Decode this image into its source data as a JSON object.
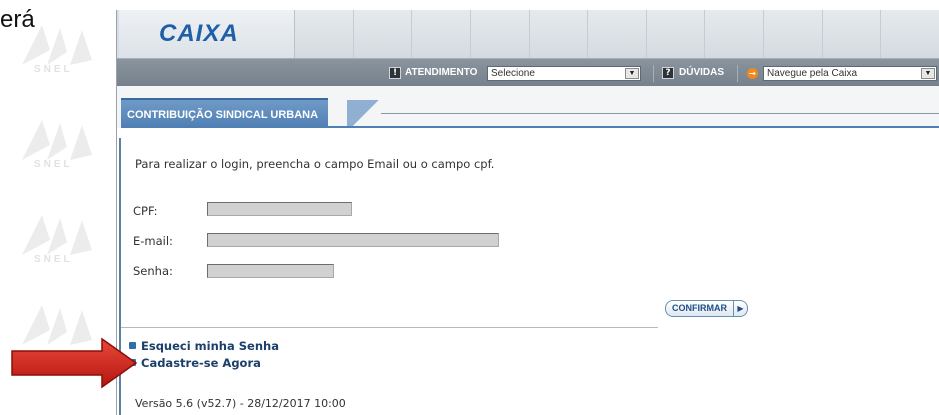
{
  "slide": {
    "fragment_text": "erá",
    "watermark_text": "SNEL"
  },
  "header": {
    "logo": "CAIXA"
  },
  "toolbar": {
    "atendimento_icon": "!",
    "atendimento_label": "ATENDIMENTO",
    "atendimento_select": "Selecione",
    "duvidas_icon": "?",
    "duvidas_label": "DÚVIDAS",
    "navegue_icon": "→",
    "navegue_select": "Navegue pela Caixa",
    "dropdown_glyph": "▼"
  },
  "tab": {
    "label": "CONTRIBUIÇÃO SINDICAL URBANA"
  },
  "login": {
    "intro": "Para realizar o login, preencha o campo Email ou o campo cpf.",
    "cpf_label": "CPF:",
    "email_label": "E-mail:",
    "senha_label": "Senha:",
    "cpf_value": "",
    "email_value": "",
    "senha_value": "",
    "confirm_label": "CONFIRMAR",
    "confirm_arrow": "▶"
  },
  "links": {
    "forgot": "Esqueci minha Senha",
    "register": "Cadastre-se Agora"
  },
  "footer": {
    "version": "Versão 5.6 (v52.7) - 28/12/2017 10:00"
  },
  "colors": {
    "accent_blue": "#4f7fb3",
    "logo_blue": "#1f5fa8",
    "toolbar_gray": "#808a94",
    "arrow_red": "#d2231c"
  },
  "icons": {
    "atendimento": "exclamation-icon",
    "duvidas": "question-icon",
    "navegue": "orange-arrow-icon",
    "links": "square-bullet-icon",
    "pointer": "red-arrow-icon"
  }
}
